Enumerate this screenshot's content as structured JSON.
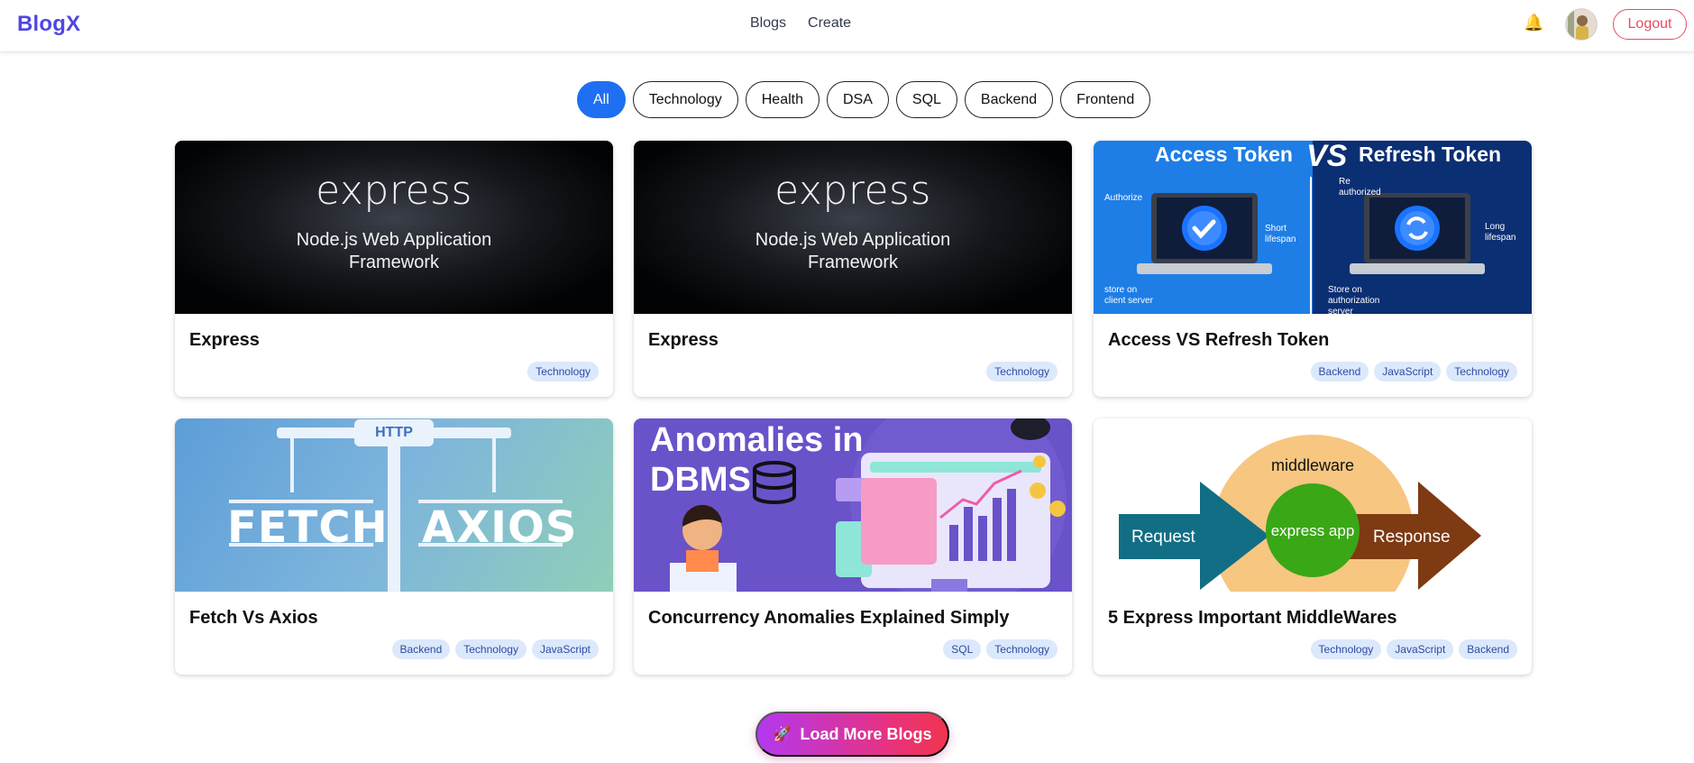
{
  "brand": "BlogX",
  "nav": {
    "links": [
      "Blogs",
      "Create"
    ]
  },
  "header_actions": {
    "notifications_icon": "bell-icon",
    "logout_label": "Logout"
  },
  "filters": {
    "active": "All",
    "items": [
      "All",
      "Technology",
      "Health",
      "DSA",
      "SQL",
      "Backend",
      "Frontend"
    ]
  },
  "cards": [
    {
      "title": "Express",
      "tags": [
        "Technology"
      ],
      "image": {
        "heading": "express",
        "subtitle_line1": "Node.js Web Application",
        "subtitle_line2": "Framework"
      }
    },
    {
      "title": "Express",
      "tags": [
        "Technology"
      ],
      "image": {
        "heading": "express",
        "subtitle_line1": "Node.js Web Application",
        "subtitle_line2": "Framework"
      }
    },
    {
      "title": "Access VS Refresh Token",
      "tags": [
        "Backend",
        "JavaScript",
        "Technology"
      ],
      "image": {
        "left_title": "Access Token",
        "vs": "VS",
        "right_title": "Refresh Token",
        "notes": [
          "Authorize",
          "Short lifespan",
          "store on client server",
          "Re authorized",
          "Long lifespan",
          "Store on authorization server"
        ]
      }
    },
    {
      "title": "Fetch Vs Axios",
      "tags": [
        "Backend",
        "Technology",
        "JavaScript"
      ],
      "image": {
        "top_label": "HTTP",
        "left_text": "FETCH",
        "right_text": "AXIOS"
      }
    },
    {
      "title": "Concurrency Anomalies Explained Simply",
      "tags": [
        "SQL",
        "Technology"
      ],
      "image": {
        "line1": "Anomalies in",
        "line2": "DBMS"
      }
    },
    {
      "title": "5 Express Important MiddleWares",
      "tags": [
        "Technology",
        "JavaScript",
        "Backend"
      ],
      "image": {
        "left": "Request",
        "center_top": "middleware",
        "center": "express app",
        "right": "Response"
      }
    }
  ],
  "load_more": {
    "icon": "rocket-icon",
    "label": "Load More Blogs"
  },
  "colors": {
    "brand": "#4f46e5",
    "active_chip": "#1f6ff2",
    "logout": "#e84c5f",
    "tag_bg": "#dce8fb"
  }
}
